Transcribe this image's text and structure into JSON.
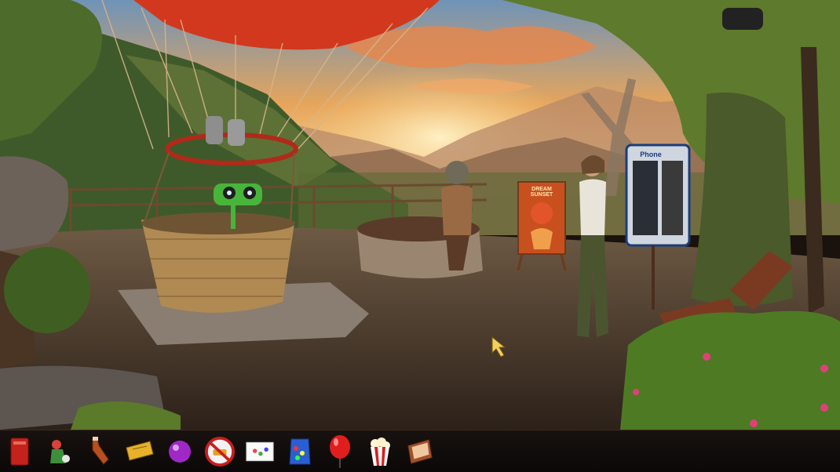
{
  "scene": {
    "phone_booth_label": "Phone",
    "poster_title": "DREAM SUNSET"
  },
  "inventory": {
    "items": [
      {
        "name": "red book"
      },
      {
        "name": "toy figurine"
      },
      {
        "name": "sauce bottle"
      },
      {
        "name": "ticket"
      },
      {
        "name": "purple ball"
      },
      {
        "name": "no-car sign"
      },
      {
        "name": "greeting card"
      },
      {
        "name": "candy bag"
      },
      {
        "name": "red balloon"
      },
      {
        "name": "popcorn"
      },
      {
        "name": "photo frame"
      }
    ]
  },
  "colors": {
    "sky_top": "#6f93b8",
    "sky_glow": "#f7c777",
    "balloon_red": "#d2381e",
    "inventory_bg": "#120d0a"
  }
}
